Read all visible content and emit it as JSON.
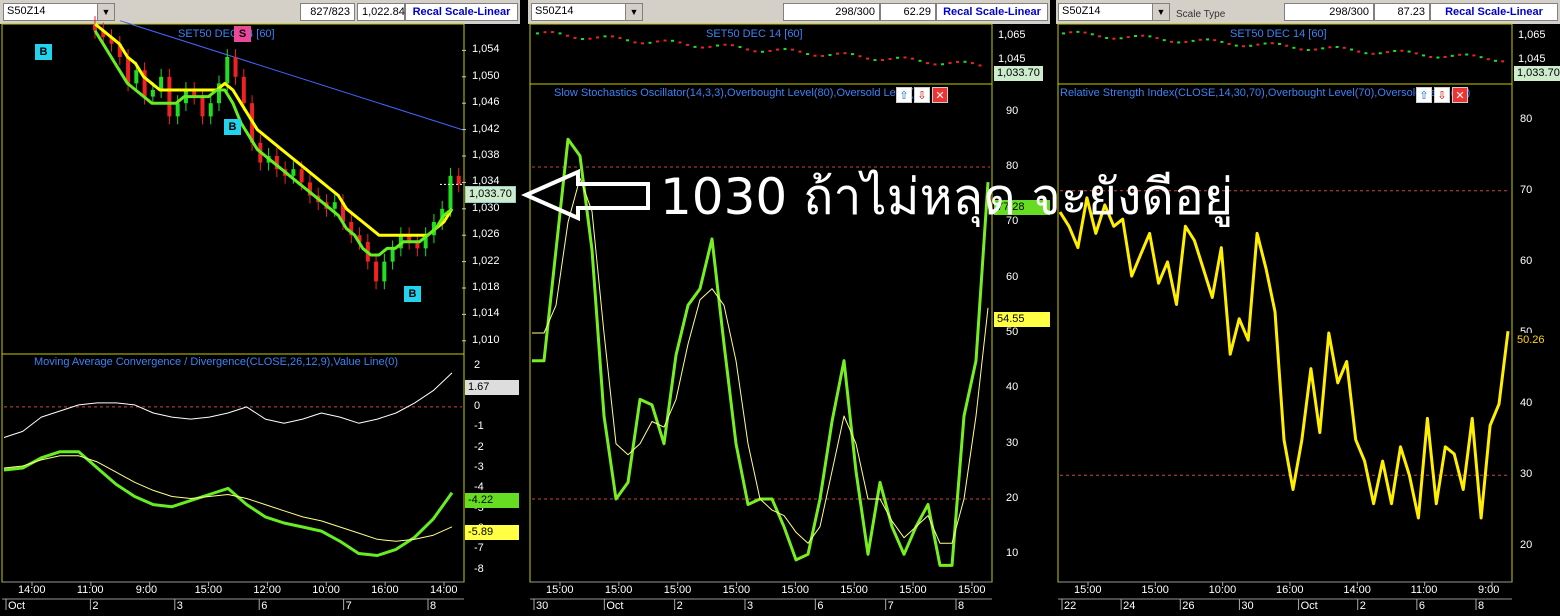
{
  "overlay_text": "1030 ถ้าไม่หลุด จะยังดีอยู่",
  "panels": [
    {
      "symbol": "S50Z14",
      "counter": "827/823",
      "value": "1,022.84",
      "recal": "Recal Scale-Linear",
      "price_title": "SET50 DEC 14  [60]",
      "macd_title": "Moving Average Convergence / Divergence(CLOSE,26,12,9),Value Line(0)",
      "price_ticks": [
        "1,054",
        "1,050",
        "1,046",
        "1,042",
        "1,038",
        "1,034",
        "1,030",
        "1,026",
        "1,022",
        "1,018",
        "1,014",
        "1,010"
      ],
      "price_last": "1,033.70",
      "macd_ticks": [
        "2",
        "1",
        "0",
        "-1",
        "-2",
        "-3",
        "-4",
        "-5",
        "-6",
        "-7",
        "-8"
      ],
      "macd_tags": [
        "1.67",
        "-4.22",
        "-5.89"
      ],
      "time_labels": [
        "14:00",
        "11:00",
        "9:00",
        "15:00",
        "12:00",
        "10:00",
        "16:00",
        "14:00"
      ],
      "date_labels": [
        "Oct",
        "2",
        "3",
        "6",
        "7",
        "8"
      ],
      "signals": [
        "B",
        "S",
        "B",
        "B"
      ]
    },
    {
      "symbol": "S50Z14",
      "counter": "298/300",
      "value": "62.29",
      "recal": "Recal Scale-Linear",
      "mini_title": "SET50 DEC 14  [60]",
      "mini_ticks": [
        "1,065",
        "1,045"
      ],
      "mini_last": "1,033.70",
      "osc_title": "Slow Stochastics Oscillator(14,3,3),Overbought Level(80),Oversold Level(20)",
      "osc_ticks": [
        "90",
        "80",
        "70",
        "60",
        "50",
        "40",
        "30",
        "20",
        "10"
      ],
      "osc_tags": [
        "77.28",
        "54.55"
      ],
      "time_labels": [
        "15:00",
        "15:00",
        "15:00",
        "15:00",
        "15:00",
        "15:00",
        "15:00",
        "15:00"
      ],
      "date_labels": [
        "30",
        "Oct",
        "2",
        "3",
        "6",
        "7",
        "8"
      ]
    },
    {
      "symbol": "S50Z14",
      "scale_type": "Scale Type",
      "counter": "298/300",
      "value": "87.23",
      "recal": "Recal Scale-Linear",
      "mini_title": "SET50 DEC 14  [60]",
      "mini_ticks": [
        "1,065",
        "1,045"
      ],
      "mini_last": "1,033.70",
      "rsi_title": "Relative Strength Index(CLOSE,14,30,70),Overbought Level(70),Oversold Level(30)",
      "rsi_ticks": [
        "80",
        "70",
        "60",
        "50",
        "40",
        "30",
        "20"
      ],
      "rsi_tag": "50.26",
      "time_labels": [
        "15:00",
        "15:00",
        "10:00",
        "16:00",
        "14:00",
        "11:00",
        "9:00"
      ],
      "date_labels": [
        "22",
        "24",
        "26",
        "30",
        "Oct",
        "2",
        "6",
        "8"
      ]
    }
  ],
  "chart_data": [
    {
      "type": "candlestick",
      "title": "SET50 DEC 14  [60]",
      "ylim": [
        1008,
        1058
      ],
      "close": [
        1057,
        1056,
        1055,
        1053,
        1049,
        1051,
        1047,
        1048,
        1050,
        1044,
        1046,
        1048,
        1047,
        1044,
        1046,
        1049,
        1053,
        1050,
        1046,
        1040,
        1037,
        1038,
        1036,
        1035,
        1036,
        1034,
        1032,
        1031,
        1030,
        1031,
        1028,
        1026,
        1025,
        1022,
        1019,
        1022,
        1024,
        1026,
        1025,
        1024,
        1026,
        1028,
        1030,
        1035,
        1033.7
      ],
      "ma_fast": [
        1057,
        1055,
        1053,
        1051,
        1049,
        1048,
        1047,
        1046,
        1046,
        1046,
        1046,
        1047,
        1047,
        1047,
        1047,
        1048,
        1048,
        1046,
        1043,
        1041,
        1039,
        1038,
        1037,
        1036,
        1035,
        1034,
        1033,
        1032,
        1031,
        1030,
        1029,
        1027,
        1026,
        1024,
        1023,
        1023,
        1024,
        1024,
        1025,
        1025,
        1025,
        1026,
        1027,
        1029,
        1030
      ],
      "ma_slow": [
        1058,
        1057,
        1056,
        1055,
        1053,
        1052,
        1050,
        1049,
        1048,
        1048,
        1048,
        1048,
        1048,
        1048,
        1048,
        1048,
        1049,
        1048,
        1046,
        1044,
        1042,
        1041,
        1040,
        1039,
        1038,
        1037,
        1036,
        1035,
        1034,
        1033,
        1032,
        1030,
        1029,
        1028,
        1027,
        1026,
        1026,
        1026,
        1026,
        1026,
        1026,
        1026,
        1027,
        1028,
        1030
      ],
      "trendline": [
        [
          1058.5,
          0
        ],
        [
          1042,
          1
        ]
      ],
      "last_value": 1033.7
    },
    {
      "type": "line",
      "title": "Moving Average Convergence / Divergence(CLOSE,26,12,9),Value Line(0)",
      "ylim": [
        -8.6,
        2.6
      ],
      "series": [
        {
          "values": [
            -1.5,
            -1.2,
            -0.5,
            -0.2,
            0.1,
            0.2,
            0.2,
            0.1,
            -0.3,
            -0.5,
            -0.6,
            -0.5,
            -0.3,
            0,
            -0.6,
            -0.8,
            -0.6,
            -0.3,
            -0.5,
            -0.8,
            -0.6,
            -0.3,
            0.2,
            0.8,
            1.67
          ]
        },
        {
          "values": [
            -3.1,
            -3.0,
            -2.5,
            -2.2,
            -2.2,
            -3.0,
            -3.8,
            -4.4,
            -4.8,
            -4.9,
            -4.6,
            -4.3,
            -4.0,
            -4.8,
            -5.4,
            -5.7,
            -5.9,
            -6.1,
            -6.6,
            -7.2,
            -7.3,
            -7.0,
            -6.4,
            -5.5,
            -4.22
          ]
        },
        {
          "values": [
            -3.0,
            -2.9,
            -2.6,
            -2.4,
            -2.4,
            -2.7,
            -3.2,
            -3.7,
            -4.1,
            -4.4,
            -4.5,
            -4.4,
            -4.3,
            -4.5,
            -4.8,
            -5.1,
            -5.4,
            -5.6,
            -5.9,
            -6.2,
            -6.5,
            -6.6,
            -6.5,
            -6.3,
            -5.89
          ]
        }
      ],
      "value_line": 0
    },
    {
      "type": "line",
      "title": "Slow Stochastics Oscillator(14,3,3),Overbought Level(80),Oversold Level(20)",
      "ylim": [
        5,
        95
      ],
      "overbought": 80,
      "oversold": 20,
      "series": [
        {
          "values": [
            45,
            45,
            65,
            85,
            82,
            65,
            35,
            20,
            23,
            38,
            37,
            30,
            46,
            55,
            58,
            67,
            48,
            30,
            19,
            20,
            20,
            15,
            9,
            10,
            20,
            34,
            45,
            25,
            10,
            23,
            15,
            10,
            15,
            19,
            8,
            8,
            35,
            45,
            77.28
          ]
        },
        {
          "values": [
            50,
            50,
            55,
            70,
            78,
            72,
            50,
            30,
            28,
            30,
            34,
            33,
            38,
            48,
            56,
            58,
            55,
            45,
            30,
            20,
            18,
            17,
            14,
            12,
            15,
            25,
            35,
            30,
            20,
            20,
            16,
            13,
            15,
            17,
            12,
            12,
            20,
            35,
            54.55
          ]
        }
      ]
    },
    {
      "type": "line",
      "title": "Relative Strength Index(CLOSE,14,30,70),Overbought Level(70),Oversold Level(30)",
      "ylim": [
        15,
        85
      ],
      "overbought": 70,
      "oversold": 30,
      "series": [
        {
          "values": [
            67,
            65,
            62,
            69,
            64,
            68,
            65,
            66,
            58,
            61,
            64,
            57,
            60,
            54,
            65,
            63,
            59,
            55,
            62,
            47,
            52,
            49,
            64,
            59,
            53,
            35,
            28,
            35,
            45,
            36,
            50,
            43,
            46,
            35,
            32,
            26,
            32,
            26,
            34,
            30,
            24,
            38,
            26,
            34,
            33,
            28,
            38,
            24,
            37,
            40,
            50.26
          ]
        }
      ]
    }
  ]
}
